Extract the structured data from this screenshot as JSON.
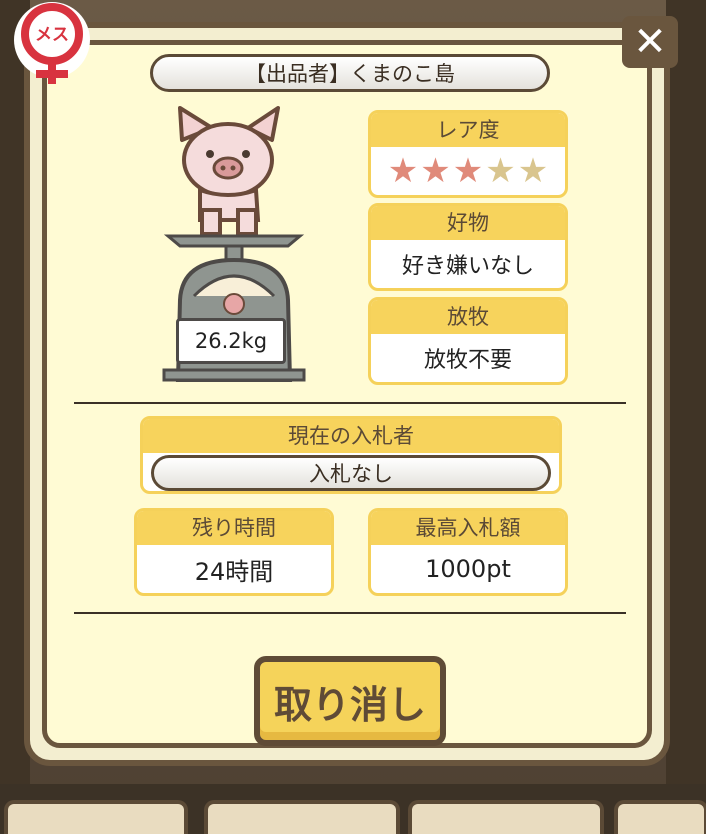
{
  "seller": {
    "label": "【出品者】くまのこ島"
  },
  "gender": {
    "text": "メス"
  },
  "weight": {
    "value": "26.2kg"
  },
  "rarity": {
    "header": "レア度",
    "stars_filled": 3,
    "stars_total": 5
  },
  "favorite": {
    "header": "好物",
    "value": "好き嫌いなし"
  },
  "grazing": {
    "header": "放牧",
    "value": "放牧不要"
  },
  "current_bidder": {
    "header": "現在の入札者",
    "value": "入札なし"
  },
  "time_left": {
    "header": "残り時間",
    "value": "24時間"
  },
  "max_bid": {
    "header": "最高入札額",
    "value": "1000pt"
  },
  "buttons": {
    "cancel": "取り消し",
    "close": "✕"
  },
  "colors": {
    "frame": "#6a563e",
    "panel": "#fffbd4",
    "accent": "#f7d35c",
    "star_on": "#e08a7a",
    "star_off": "#d9c58e",
    "badge": "#d8333f"
  }
}
